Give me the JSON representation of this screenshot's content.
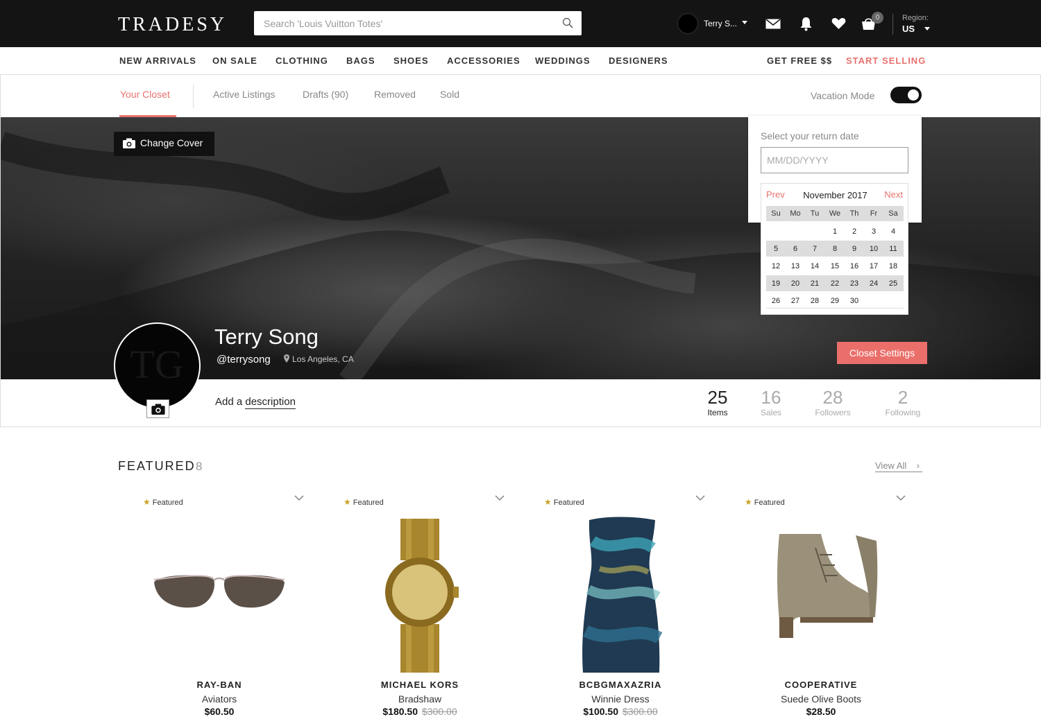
{
  "header": {
    "logo": "TRADESY",
    "search_placeholder": "Search 'Louis Vuitton Totes'",
    "user_name": "Terry S...",
    "cart_count": "0",
    "region_label": "Region:",
    "region_value": "US"
  },
  "nav": {
    "items": [
      "NEW ARRIVALS",
      "ON SALE",
      "CLOTHING",
      "BAGS",
      "SHOES",
      "ACCESSORIES",
      "WEDDINGS",
      "DESIGNERS"
    ],
    "free": "GET FREE $$",
    "sell": "START SELLING"
  },
  "tabs": [
    "Your Closet",
    "Active Listings",
    "Drafts (90)",
    "Removed",
    "Sold"
  ],
  "vacation": {
    "label": "Vacation Mode",
    "enabled": true,
    "date_label": "Select your return date",
    "date_placeholder": "MM/DD/YYYY"
  },
  "calendar": {
    "prev": "Prev",
    "next": "Next",
    "month": "November 2017",
    "dow": [
      "Su",
      "Mo",
      "Tu",
      "We",
      "Th",
      "Fr",
      "Sa"
    ],
    "weeks": [
      [
        "",
        "",
        "",
        "1",
        "2",
        "3",
        "4"
      ],
      [
        "5",
        "6",
        "7",
        "8",
        "9",
        "10",
        "11"
      ],
      [
        "12",
        "13",
        "14",
        "15",
        "16",
        "17",
        "18"
      ],
      [
        "19",
        "20",
        "21",
        "22",
        "23",
        "24",
        "25"
      ],
      [
        "26",
        "27",
        "28",
        "29",
        "30",
        "",
        ""
      ]
    ]
  },
  "profile": {
    "change_cover": "Change Cover",
    "name": "Terry Song",
    "handle": "@terrysong",
    "location": "Los Angeles, CA",
    "closet_settings": "Closet Settings",
    "add_prefix": "Add a",
    "add_link": "description",
    "stats": [
      {
        "num": "25",
        "label": "Items"
      },
      {
        "num": "16",
        "label": "Sales"
      },
      {
        "num": "28",
        "label": "Followers"
      },
      {
        "num": "2",
        "label": "Following"
      }
    ]
  },
  "featured": {
    "title": "FEATURED",
    "count": "8",
    "view_all": "View All",
    "badge": "Featured",
    "items": [
      {
        "brand": "RAY-BAN",
        "name": "Aviators",
        "price": "$60.50",
        "orig": ""
      },
      {
        "brand": "MICHAEL KORS",
        "name": "Bradshaw",
        "price": "$180.50",
        "orig": "$300.00"
      },
      {
        "brand": "BCBGMAXAZRIA",
        "name": "Winnie Dress",
        "price": "$100.50",
        "orig": "$300.00"
      },
      {
        "brand": "COOPERATIVE",
        "name": "Suede Olive Boots",
        "price": "$28.50",
        "orig": ""
      }
    ]
  },
  "colors": {
    "accent": "#e8726e",
    "topbar": "#141414",
    "button": "#ea6f6a"
  }
}
